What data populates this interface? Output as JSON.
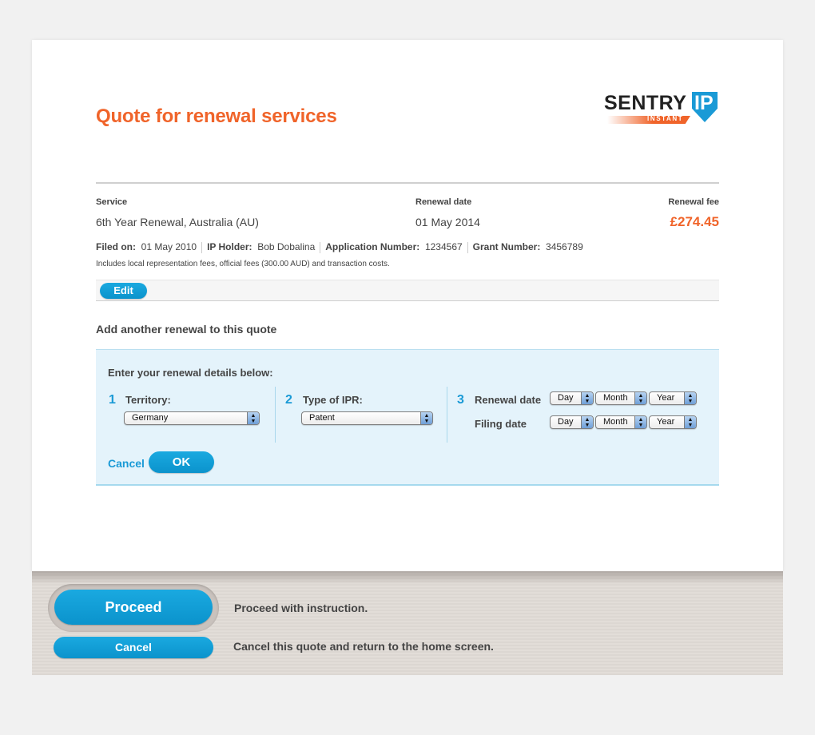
{
  "header": {
    "title": "Quote for renewal services",
    "logo": {
      "word": "SENTRY",
      "badge": "IP",
      "tagline": "INSTANT"
    }
  },
  "quote": {
    "columns": {
      "service": "Service",
      "renewal_date": "Renewal date",
      "renewal_fee": "Renewal fee"
    },
    "service": "6th Year Renewal, Australia (AU)",
    "renewal_date": "01 May 2014",
    "renewal_fee": "£274.45",
    "meta": [
      {
        "label": "Filed on:",
        "value": "01 May 2010"
      },
      {
        "label": "IP Holder:",
        "value": "Bob Dobalina"
      },
      {
        "label": "Application Number:",
        "value": "1234567"
      },
      {
        "label": "Grant Number:",
        "value": "3456789"
      }
    ],
    "note": "Includes local representation fees, official fees (300.00 AUD) and transaction costs.",
    "edit_label": "Edit"
  },
  "add_renewal": {
    "title": "Add another renewal to this quote",
    "panel_title": "Enter your renewal details below:",
    "steps": [
      {
        "num": "1",
        "label": "Territory:",
        "value": "Germany"
      },
      {
        "num": "2",
        "label": "Type of IPR:",
        "value": "Patent"
      },
      {
        "num": "3",
        "renewal_label": "Renewal date",
        "filing_label": "Filing date",
        "renewal": {
          "day": "Day",
          "month": "Month",
          "year": "Year"
        },
        "filing": {
          "day": "Day",
          "month": "Month",
          "year": "Year"
        }
      }
    ],
    "cancel_label": "Cancel",
    "ok_label": "OK"
  },
  "footer": {
    "proceed_label": "Proceed",
    "proceed_text": "Proceed with instruction.",
    "cancel_label": "Cancel",
    "cancel_text": "Cancel this quote and return to the home screen."
  },
  "colors": {
    "accent_orange": "#f0642a",
    "accent_blue": "#1a9ad6",
    "panel_bg": "#e4f3fb"
  }
}
